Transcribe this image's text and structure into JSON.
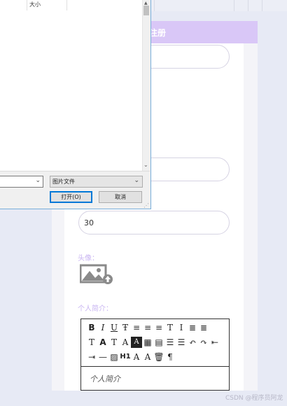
{
  "form": {
    "title": "注册",
    "age_value": "30",
    "avatar_label": "头像：",
    "intro_label": "个人简介：",
    "intro_placeholder": "个人简介",
    "accent_color": "#d9c7f7"
  },
  "file_dialog": {
    "column_size": "大小",
    "file_type_value": "图片文件",
    "open_button": "打开(O)",
    "cancel_button": "取消"
  },
  "editor_toolbar": {
    "row1": [
      {
        "icon": "bold-icon",
        "glyph": "B"
      },
      {
        "icon": "italic-icon",
        "glyph": "I"
      },
      {
        "icon": "underline-icon",
        "glyph": "U"
      },
      {
        "icon": "strikethrough-icon",
        "glyph": "Ŧ"
      },
      {
        "icon": "align-left-icon",
        "glyph": "≡"
      },
      {
        "icon": "align-center-icon",
        "glyph": "≡"
      },
      {
        "icon": "align-right-icon",
        "glyph": "≡"
      },
      {
        "icon": "text-direction-icon",
        "glyph": "T"
      },
      {
        "icon": "line-height-icon",
        "glyph": "I"
      },
      {
        "icon": "indent-icon",
        "glyph": "≣"
      },
      {
        "icon": "format-block-icon",
        "glyph": "≣"
      }
    ],
    "row2": [
      {
        "icon": "clear-format-icon",
        "glyph": "T"
      },
      {
        "icon": "font-size-icon",
        "glyph": "A"
      },
      {
        "icon": "font-family-icon",
        "glyph": "T"
      },
      {
        "icon": "font-color-icon",
        "glyph": "A"
      },
      {
        "icon": "background-color-icon",
        "glyph": "A"
      },
      {
        "icon": "date-icon",
        "glyph": "▦"
      },
      {
        "icon": "paste-icon",
        "glyph": "▤"
      },
      {
        "icon": "ordered-list-icon",
        "glyph": "☰"
      },
      {
        "icon": "unordered-list-icon",
        "glyph": "☰"
      },
      {
        "icon": "undo-icon",
        "glyph": "↶"
      },
      {
        "icon": "redo-icon",
        "glyph": "↷"
      },
      {
        "icon": "outdent-icon",
        "glyph": "⇤"
      }
    ],
    "row3": [
      {
        "icon": "indent-right-icon",
        "glyph": "⇥"
      },
      {
        "icon": "horizontal-rule-icon",
        "glyph": "—"
      },
      {
        "icon": "image-icon",
        "glyph": "▨"
      },
      {
        "icon": "heading-icon",
        "glyph": "H1"
      },
      {
        "icon": "subscript-icon",
        "glyph": "A"
      },
      {
        "icon": "superscript-icon",
        "glyph": "A"
      },
      {
        "icon": "delete-icon",
        "glyph": "🗑"
      },
      {
        "icon": "paragraph-icon",
        "glyph": "¶"
      }
    ]
  },
  "watermark": "CSDN @程序员阿龙"
}
